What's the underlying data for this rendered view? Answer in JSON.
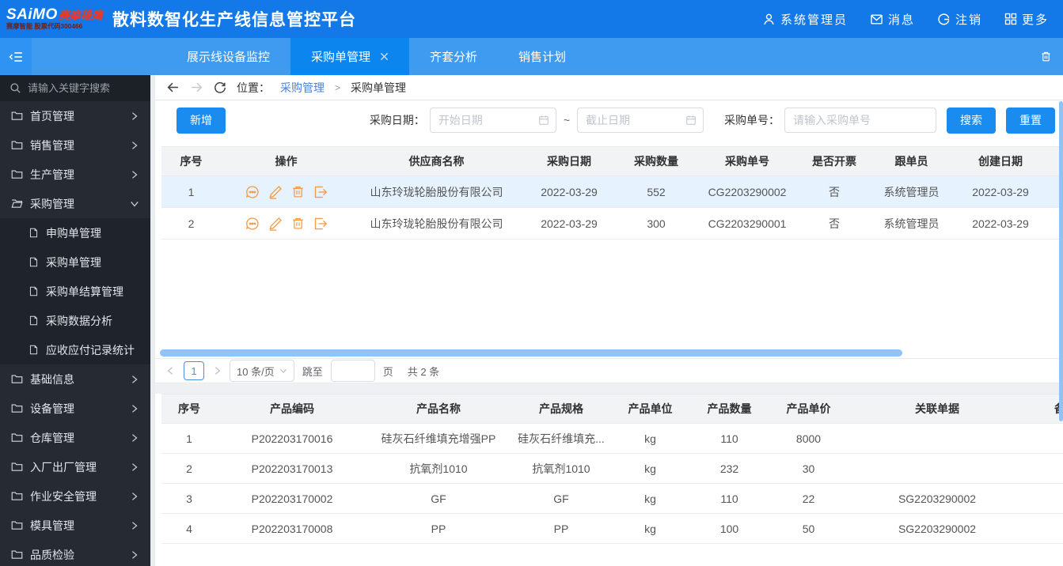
{
  "header": {
    "logo_main": "SAiMO",
    "logo_sub": "赛摩雄鹰",
    "logo_tagline": "赛摩智能 股票代码300466",
    "title": "散料数智化生产线信息管控平台",
    "user": "系统管理员",
    "messages": "消息",
    "logout": "注销",
    "more": "更多"
  },
  "tab_bar": {
    "tabs": [
      {
        "label": "展示线设备监控"
      },
      {
        "label": "采购单管理"
      },
      {
        "label": "齐套分析"
      },
      {
        "label": "销售计划"
      }
    ]
  },
  "sidebar": {
    "search_placeholder": "请输入关键字搜索",
    "groups_top": [
      {
        "label": "首页管理"
      },
      {
        "label": "销售管理"
      },
      {
        "label": "生产管理"
      },
      {
        "label": "采购管理"
      }
    ],
    "submenu": [
      {
        "label": "申购单管理"
      },
      {
        "label": "采购单管理"
      },
      {
        "label": "采购单结算管理"
      },
      {
        "label": "采购数据分析"
      },
      {
        "label": "应收应付记录统计"
      }
    ],
    "groups_bottom": [
      {
        "label": "基础信息"
      },
      {
        "label": "设备管理"
      },
      {
        "label": "仓库管理"
      },
      {
        "label": "入厂出厂管理"
      },
      {
        "label": "作业安全管理"
      },
      {
        "label": "模具管理"
      },
      {
        "label": "品质检验"
      }
    ]
  },
  "breadcrumb": {
    "location_label": "位置：",
    "parent": "采购管理",
    "separator": ">",
    "current": "采购单管理"
  },
  "toolbar": {
    "add_label": "新增",
    "date_label": "采购日期：",
    "start_placeholder": "开始日期",
    "tilde": "~",
    "end_placeholder": "截止日期",
    "order_label": "采购单号：",
    "order_placeholder": "请输入采购单号",
    "search_label": "搜索",
    "reset_label": "重置"
  },
  "orders_table": {
    "headers": [
      "序号",
      "操作",
      "供应商名称",
      "采购日期",
      "采购数量",
      "采购单号",
      "是否开票",
      "跟单员",
      "创建日期"
    ],
    "rows": [
      {
        "seq": "1",
        "supplier": "山东玲珑轮胎股份有限公司",
        "date": "2022-03-29",
        "qty": "552",
        "order_no": "CG2203290002",
        "invoiced": "否",
        "follower": "系统管理员",
        "created": "2022-03-29"
      },
      {
        "seq": "2",
        "supplier": "山东玲珑轮胎股份有限公司",
        "date": "2022-03-29",
        "qty": "300",
        "order_no": "CG2203290001",
        "invoiced": "否",
        "follower": "系统管理员",
        "created": "2022-03-29"
      }
    ]
  },
  "pagination": {
    "page": "1",
    "page_size": "10 条/页",
    "jump_label": "跳至",
    "page_label": "页",
    "total": "共 2 条"
  },
  "products_table": {
    "headers": [
      "序号",
      "产品编码",
      "产品名称",
      "产品规格",
      "产品单位",
      "产品数量",
      "产品单价",
      "关联单据",
      "备"
    ],
    "rows": [
      {
        "seq": "1",
        "code": "P202203170016",
        "name": "硅灰石纤维填充增强PP",
        "spec": "硅灰石纤维填充...",
        "unit": "kg",
        "qty": "110",
        "price": "8000",
        "related": ""
      },
      {
        "seq": "2",
        "code": "P202203170013",
        "name": "抗氧剂1010",
        "spec": "抗氧剂1010",
        "unit": "kg",
        "qty": "232",
        "price": "30",
        "related": ""
      },
      {
        "seq": "3",
        "code": "P202203170002",
        "name": "GF",
        "spec": "GF",
        "unit": "kg",
        "qty": "110",
        "price": "22",
        "related": "SG2203290002"
      },
      {
        "seq": "4",
        "code": "P202203170008",
        "name": "PP",
        "spec": "PP",
        "unit": "kg",
        "qty": "100",
        "price": "50",
        "related": "SG2203290002"
      }
    ]
  },
  "colors": {
    "header_blue": "#1379e8",
    "tabbar_blue": "#3f9bf0",
    "active_tab_blue": "#0c86ee",
    "button_blue": "#1a8cf0",
    "sidebar_dark": "#262a32",
    "action_icon_orange": "#f0a050",
    "selected_row": "#e6f2fd",
    "scrollbar_thumb": "#90c3f7",
    "logo_red": "#e8392b"
  }
}
